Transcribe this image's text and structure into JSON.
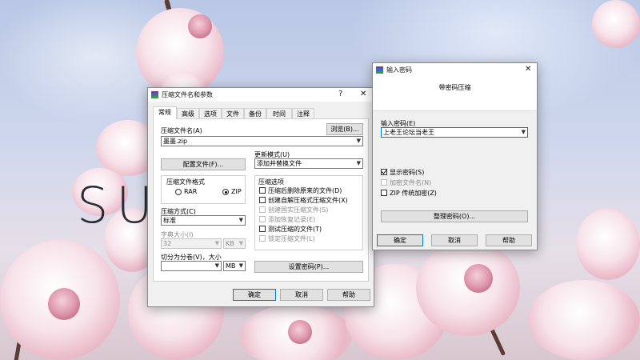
{
  "desktop": {
    "brand_text": "SU"
  },
  "archive_dialog": {
    "title": "压缩文件名和参数",
    "help_glyph": "?",
    "close_glyph": "✕",
    "tabs": [
      {
        "label": "常规",
        "active": true
      },
      {
        "label": "高级"
      },
      {
        "label": "选项"
      },
      {
        "label": "文件"
      },
      {
        "label": "备份"
      },
      {
        "label": "时间"
      },
      {
        "label": "注释"
      }
    ],
    "archive_name_label": "压缩文件名(A)",
    "browse_label": "浏览(B)...",
    "archive_name_value": "墨墨.zip",
    "profiles_label": "配置文件(F)...",
    "update_mode_label": "更新模式(U)",
    "update_mode_value": "添加并替换文件",
    "format_group_label": "压缩文件格式",
    "format_rar": "RAR",
    "format_zip": "ZIP",
    "selected_format": "ZIP",
    "options_group_label": "压缩选项",
    "options": [
      {
        "label": "压缩后删除原来的文件(D)",
        "checked": false,
        "enabled": true
      },
      {
        "label": "创建自解压格式压缩文件(X)",
        "checked": false,
        "enabled": true
      },
      {
        "label": "创建固实压缩文件(S)",
        "checked": false,
        "enabled": false
      },
      {
        "label": "添加恢复记录(E)",
        "checked": false,
        "enabled": false
      },
      {
        "label": "测试压缩的文件(T)",
        "checked": false,
        "enabled": true
      },
      {
        "label": "锁定压缩文件(L)",
        "checked": false,
        "enabled": false
      }
    ],
    "method_label": "压缩方式(C)",
    "method_value": "标准",
    "dict_label": "字典大小(I)",
    "dict_value": "32",
    "dict_unit": "KB",
    "split_label": "切分为分卷(V)，大小",
    "split_value": "",
    "split_unit": "MB",
    "set_password_label": "设置密码(P)...",
    "ok_label": "确定",
    "cancel_label": "取消",
    "help_label": "帮助"
  },
  "password_dialog": {
    "title": "输入密码",
    "close_glyph": "✕",
    "header": "带密码压缩",
    "enter_label": "输入密码(E)",
    "password_value": "上老王论坛当老王",
    "show_password": {
      "label": "显示密码(S)",
      "checked": true,
      "enabled": true
    },
    "encrypt_names": {
      "label": "加密文件名(N)",
      "checked": false,
      "enabled": false
    },
    "zip_legacy": {
      "label": "ZIP 传统加密(Z)",
      "checked": false,
      "enabled": true
    },
    "organize_label": "整理密码(O)...",
    "ok_label": "确定",
    "cancel_label": "取消",
    "help_label": "帮助"
  },
  "colors": {
    "accent": "#0078d7",
    "blossom_pink": "#e9b7c6",
    "sky": "#b9c8e6"
  }
}
